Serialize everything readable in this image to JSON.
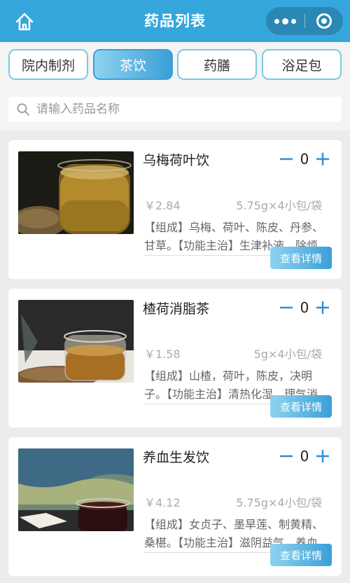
{
  "header": {
    "title": "药品列表",
    "home_icon": "home-icon",
    "more_icon": "more-dots-icon",
    "close_icon": "target-circle-icon"
  },
  "tabs": [
    {
      "label": "院内制剂",
      "active": false
    },
    {
      "label": "茶饮",
      "active": true
    },
    {
      "label": "药膳",
      "active": false
    },
    {
      "label": "浴足包",
      "active": false
    }
  ],
  "search": {
    "placeholder": "请输入药品名称",
    "value": ""
  },
  "products": [
    {
      "name": "乌梅荷叶饮",
      "qty": "0",
      "price": "￥2.84",
      "spec": "5.75g×4小包/袋",
      "desc": "【组成】乌梅、荷叶、陈皮、丹参、甘草。【功能主治】生津补液，除烦止渴。",
      "button": "查看详情"
    },
    {
      "name": "楂荷消脂茶",
      "qty": "0",
      "price": "￥1.58",
      "spec": "5g×4小包/袋",
      "desc": "【组成】山楂，荷叶，陈皮，决明子。【功能主治】清热化湿，理气消脂。",
      "button": "查看详情"
    },
    {
      "name": "养血生发饮",
      "qty": "0",
      "price": "￥4.12",
      "spec": "5.75g×4小包/袋",
      "desc": "【组成】女贞子、墨旱莲、制黄精、桑椹。【功能主治】滋阴益气，养血生发。",
      "button": "查看详情"
    }
  ],
  "colors": {
    "primary": "#35a7dc",
    "accent": "#2f8fd6",
    "background": "#ececec"
  }
}
